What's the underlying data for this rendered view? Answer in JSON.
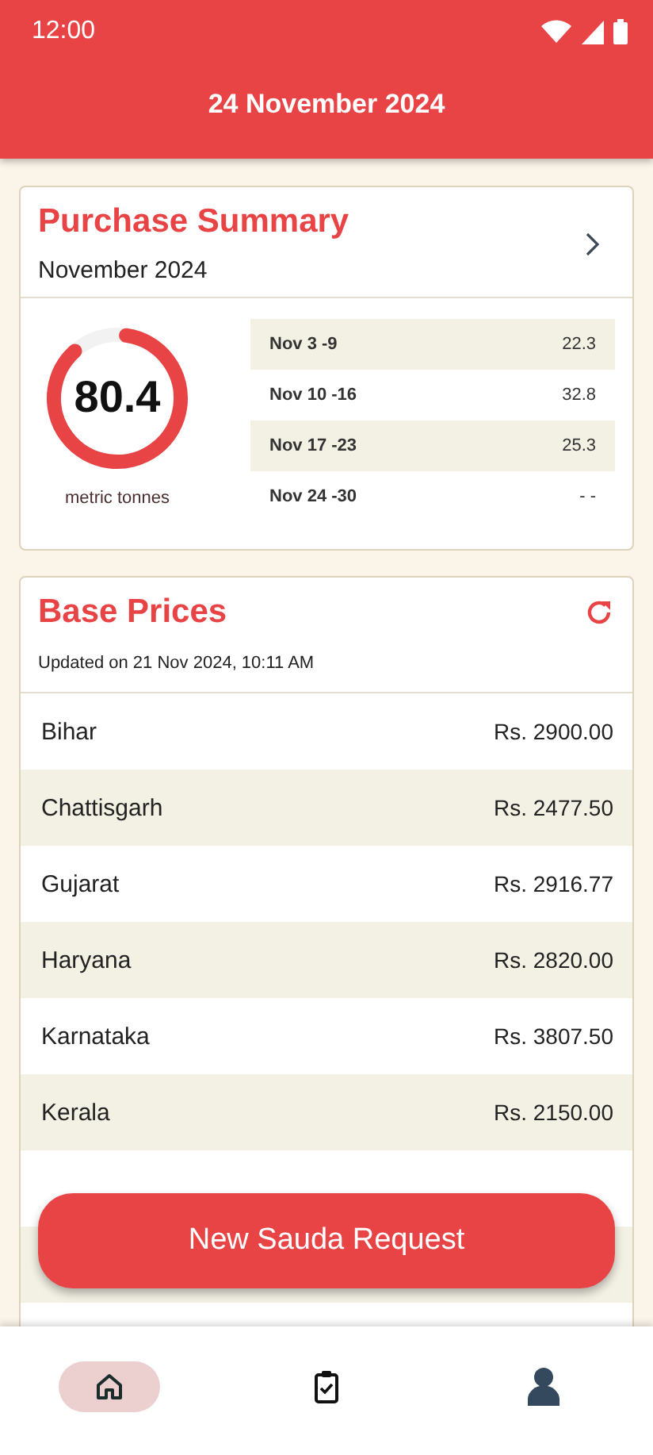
{
  "status_bar": {
    "time": "12:00"
  },
  "header": {
    "title": "24 November 2024"
  },
  "purchase_summary": {
    "title": "Purchase Summary",
    "month": "November 2024",
    "total": "80.4",
    "level": 0.86,
    "unit": "metric tonnes",
    "weeks": [
      {
        "label": "Nov 3 -9",
        "value": "22.3"
      },
      {
        "label": "Nov 10 -16",
        "value": "32.8"
      },
      {
        "label": "Nov 17 -23",
        "value": "25.3"
      },
      {
        "label": "Nov 24 -30",
        "value": "- -"
      }
    ]
  },
  "base_prices": {
    "title": "Base Prices",
    "updated": "Updated on 21 Nov 2024, 10:11 AM",
    "rows": [
      {
        "state": "Bihar",
        "price": "Rs. 2900.00"
      },
      {
        "state": "Chattisgarh",
        "price": "Rs. 2477.50"
      },
      {
        "state": "Gujarat",
        "price": "Rs. 2916.77"
      },
      {
        "state": "Haryana",
        "price": "Rs. 2820.00"
      },
      {
        "state": "Karnataka",
        "price": "Rs. 3807.50"
      },
      {
        "state": "Kerala",
        "price": "Rs. 2150.00"
      }
    ]
  },
  "action_button": {
    "label": "New Sauda Request"
  },
  "bottom_nav": [
    {
      "kind": "home",
      "selected": true
    },
    {
      "kind": "tasks",
      "selected": false
    },
    {
      "kind": "profile",
      "selected": false
    }
  ]
}
